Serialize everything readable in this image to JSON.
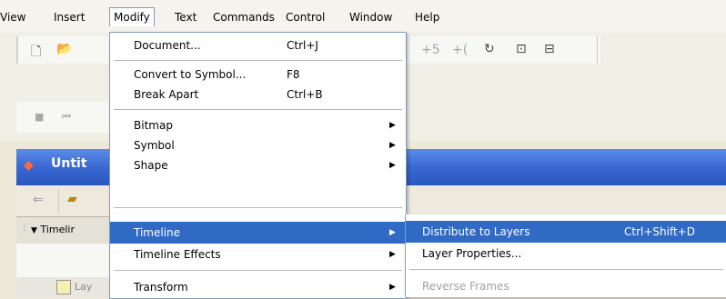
{
  "menubar": {
    "items": [
      "View",
      "Insert",
      "Modify",
      "Text",
      "Commands",
      "Control",
      "Window",
      "Help"
    ],
    "active": "Modify"
  },
  "document": {
    "title": "Untit"
  },
  "timeline": {
    "label": "Timelir"
  },
  "layer": {
    "label": "Lay"
  },
  "modify_menu": {
    "items": [
      {
        "label": "Document...",
        "shortcut": "Ctrl+J"
      },
      {
        "label": "Convert to Symbol...",
        "shortcut": "F8"
      },
      {
        "label": "Break Apart",
        "shortcut": "Ctrl+B"
      },
      {
        "label": "Bitmap",
        "submenu": true
      },
      {
        "label": "Symbol",
        "submenu": true
      },
      {
        "label": "Shape",
        "submenu": true
      },
      {
        "label": "Timeline",
        "submenu": true,
        "highlighted": true
      },
      {
        "label": "Timeline Effects",
        "submenu": true
      },
      {
        "label": "Transform",
        "submenu": true
      }
    ]
  },
  "timeline_submenu": {
    "items": [
      {
        "label": "Distribute to Layers",
        "shortcut": "Ctrl+Shift+D",
        "highlighted": true
      },
      {
        "label": "Layer Properties..."
      },
      {
        "label": "Reverse Frames",
        "disabled": true
      }
    ]
  },
  "colors": {
    "highlight": "#316ac5",
    "titlebar": "#3968d2"
  }
}
